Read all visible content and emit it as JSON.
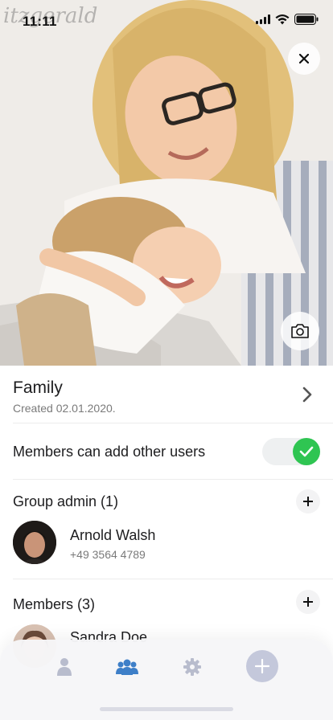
{
  "status_bar": {
    "time": "11:11"
  },
  "hero": {
    "watermark": "itzgerald",
    "icons": {
      "close": "close-icon",
      "camera": "camera-icon"
    }
  },
  "group": {
    "name": "Family",
    "created": "Created 02.01.2020."
  },
  "settings": {
    "members_can_add_label": "Members can add other users",
    "members_can_add_enabled": true
  },
  "admins": {
    "title": "Group admin (1)",
    "items": [
      {
        "name": "Arnold Walsh",
        "phone": "+49 3564 4789"
      }
    ]
  },
  "members": {
    "title": "Members (3)",
    "items": [
      {
        "name": "Sandra Doe"
      }
    ]
  },
  "tabbar": {
    "items": [
      "person-icon",
      "group-icon",
      "settings-gear-icon",
      "add-plus-icon"
    ],
    "active": "group-icon"
  },
  "colors": {
    "toggle_on": "#2fc552",
    "tab_active": "#3e7fc8",
    "tab_inactive": "#b8bccd"
  }
}
